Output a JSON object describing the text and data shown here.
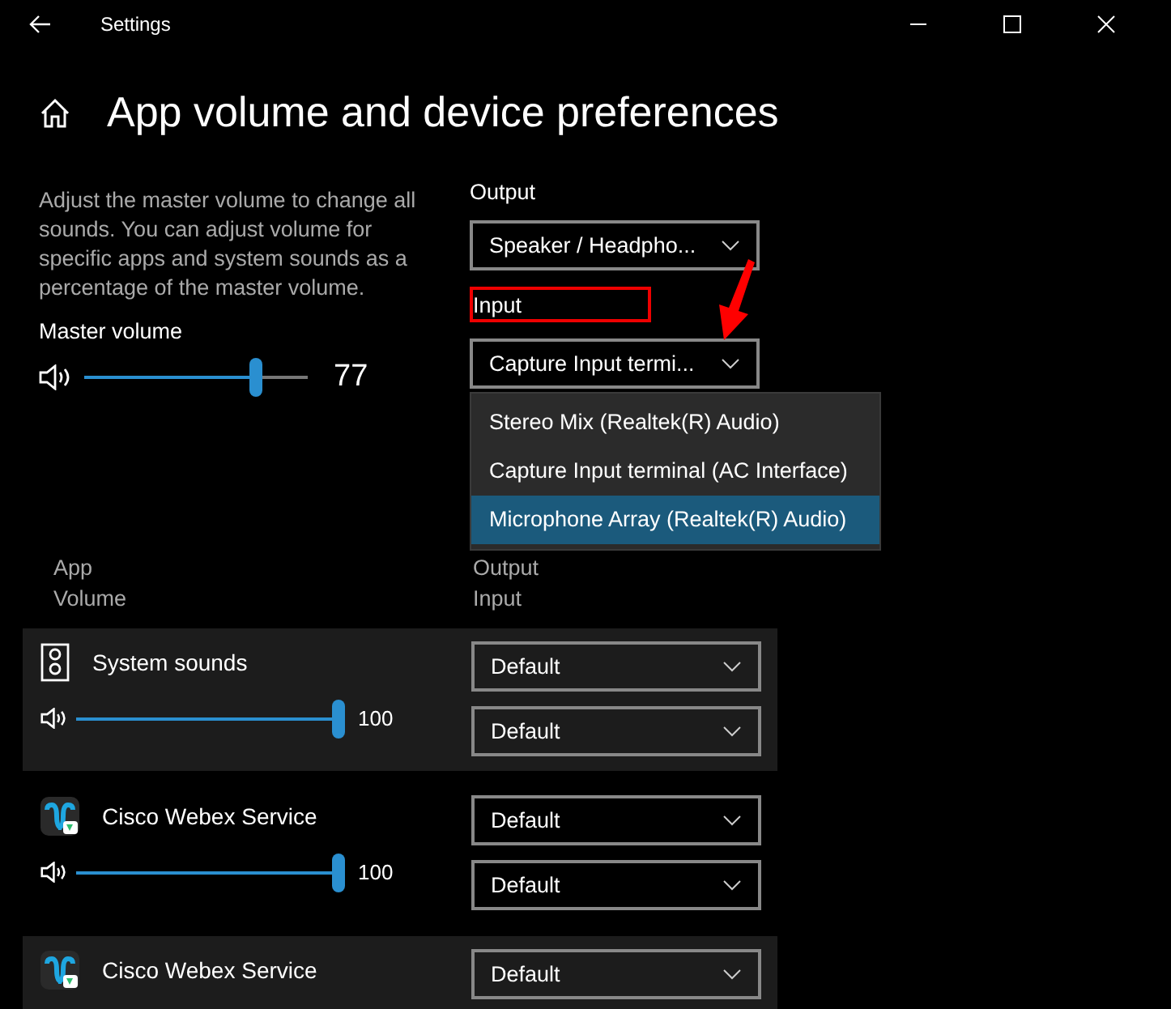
{
  "window": {
    "title": "Settings"
  },
  "page_title": "App volume and device preferences",
  "description": "Adjust the master volume to change all sounds. You can adjust volume for specific apps and system sounds as a percentage of the master volume.",
  "master": {
    "label": "Master volume",
    "level": 0.77,
    "reading": "77"
  },
  "output": {
    "label": "Output",
    "value": "Speaker / Headpho..."
  },
  "input": {
    "label": "Input",
    "value": "Capture Input termi...",
    "highlighted": true,
    "expanded": true,
    "options": [
      {
        "label": "Stereo Mix (Realtek(R) Audio)",
        "selected": false
      },
      {
        "label": "Capture Input terminal (AC Interface)",
        "selected": false
      },
      {
        "label": "Microphone Array (Realtek(R) Audio)",
        "selected": true
      }
    ]
  },
  "list_header": {
    "app": "App",
    "volume": "Volume",
    "output": "Output",
    "input": "Input"
  },
  "apps": [
    {
      "kind": "system",
      "name": "System sounds",
      "level": 1,
      "reading": "100",
      "output": "Default",
      "input": "Default"
    },
    {
      "kind": "app",
      "name": "Cisco Webex Service",
      "level": 1,
      "reading": "100",
      "output": "Default",
      "input": "Default"
    },
    {
      "kind": "app",
      "name": "Cisco Webex Service",
      "output": "Default"
    }
  ]
}
